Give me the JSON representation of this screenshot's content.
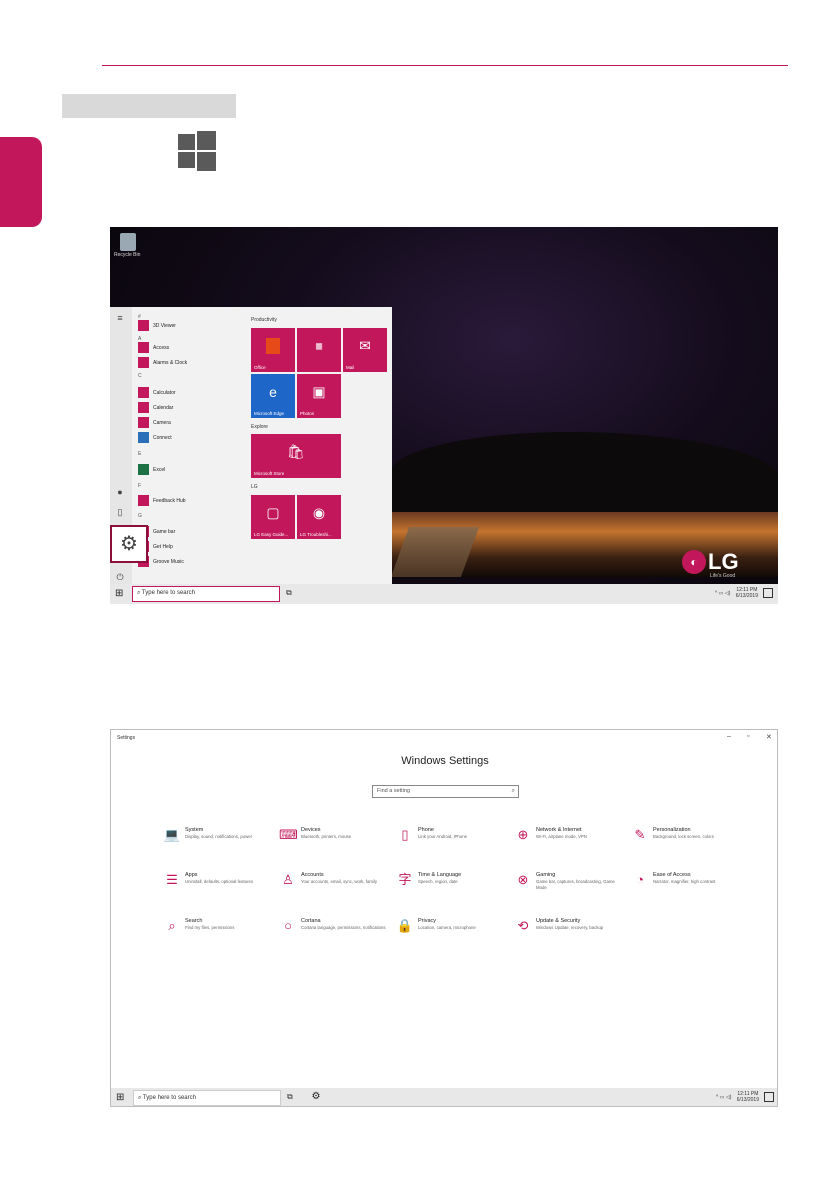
{
  "colors": {
    "accent": "#c2185b",
    "tile": "#c2185b",
    "highlight_border": "#8b0f3a"
  },
  "desktop": {
    "recycle_bin": "Recycle Bin",
    "start_menu": {
      "letters": [
        "#",
        "A",
        "C",
        "E",
        "F",
        "G"
      ],
      "apps": [
        "3D Viewer",
        "Access",
        "Alarms & Clock",
        "Calculator",
        "Calendar",
        "Camera",
        "Connect",
        "Excel",
        "Feedback Hub",
        "Game bar",
        "Get Help",
        "Groove Music"
      ],
      "groups": {
        "productivity": "Productivity",
        "explore": "Explore",
        "lg": "LG"
      },
      "tiles": {
        "office": "Office",
        "mail": "Mail",
        "edge": "Microsoft Edge",
        "photos": "Photos",
        "store": "Microsoft Store",
        "lg_easy": "LG Easy Guide...",
        "lg_trouble": "LG Troubleshi..."
      }
    },
    "taskbar": {
      "search_placeholder": "Type here to search",
      "time": "12:11 PM",
      "date": "6/13/2019"
    },
    "brand": {
      "logo": "LG",
      "slogan": "Life's Good"
    }
  },
  "settings": {
    "window_title": "Settings",
    "heading": "Windows Settings",
    "search_placeholder": "Find a setting",
    "categories": [
      {
        "name": "System",
        "desc": "Display, sound, notifications, power",
        "icon": "laptop-icon"
      },
      {
        "name": "Devices",
        "desc": "Bluetooth, printers, mouse",
        "icon": "keyboard-icon"
      },
      {
        "name": "Phone",
        "desc": "Link your Android, iPhone",
        "icon": "phone-icon"
      },
      {
        "name": "Network & Internet",
        "desc": "Wi-Fi, airplane mode, VPN",
        "icon": "globe-icon"
      },
      {
        "name": "Personalization",
        "desc": "Background, lock screen, colors",
        "icon": "brush-icon"
      },
      {
        "name": "Apps",
        "desc": "Uninstall, defaults, optional features",
        "icon": "list-icon"
      },
      {
        "name": "Accounts",
        "desc": "Your accounts, email, sync, work, family",
        "icon": "person-icon"
      },
      {
        "name": "Time & Language",
        "desc": "Speech, region, date",
        "icon": "clock-language-icon"
      },
      {
        "name": "Gaming",
        "desc": "Game bar, captures, broadcasting, Game Mode",
        "icon": "xbox-icon"
      },
      {
        "name": "Ease of Access",
        "desc": "Narrator, magnifier, high contrast",
        "icon": "accessibility-icon"
      },
      {
        "name": "Search",
        "desc": "Find my files, permissions",
        "icon": "search-icon"
      },
      {
        "name": "Cortana",
        "desc": "Cortana language, permissions, notifications",
        "icon": "cortana-icon"
      },
      {
        "name": "Privacy",
        "desc": "Location, camera, microphone",
        "icon": "lock-icon"
      },
      {
        "name": "Update & Security",
        "desc": "Windows Update, recovery, backup",
        "icon": "update-icon"
      }
    ],
    "taskbar": {
      "search_placeholder": "Type here to search",
      "time": "12:11 PM",
      "date": "6/13/2019"
    }
  }
}
